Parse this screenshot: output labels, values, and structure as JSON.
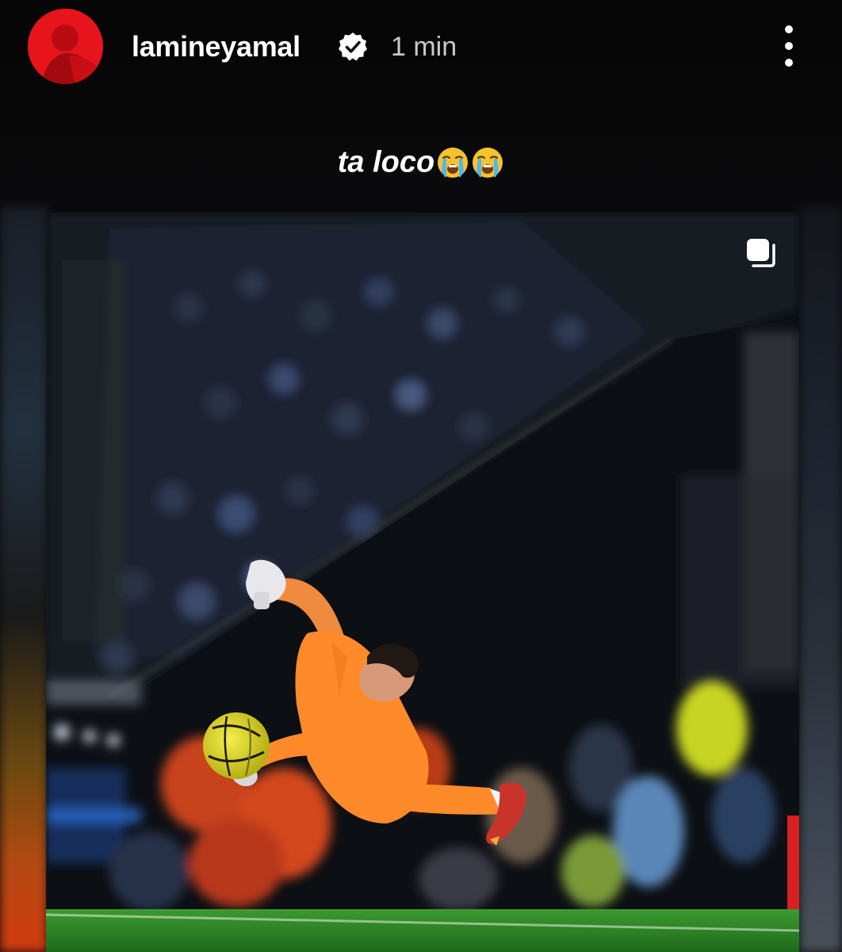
{
  "story": {
    "username": "lamineyamal",
    "time": "1 min",
    "caption": "ta loco",
    "caption_emojis": [
      "loudly-crying-face",
      "loudly-crying-face"
    ]
  },
  "icons": {
    "avatar": "profile-avatar",
    "verified": "verified-badge-icon",
    "more": "more-vertical-icon",
    "carousel": "multiple-images-icon"
  },
  "colors": {
    "avatar_red": "#e8141b",
    "keeper_kit": "#ff8a2a",
    "pitch": "#2f8a2a",
    "ball": "#e6e02a"
  }
}
